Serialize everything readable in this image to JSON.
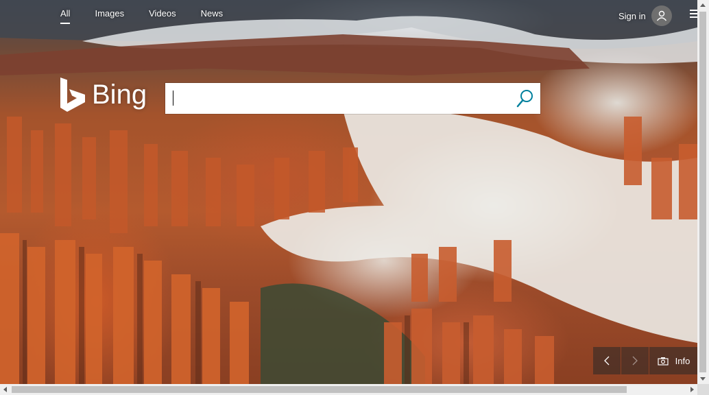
{
  "nav": {
    "tabs": [
      {
        "label": "All",
        "active": true
      },
      {
        "label": "Images",
        "active": false
      },
      {
        "label": "Videos",
        "active": false
      },
      {
        "label": "News",
        "active": false
      }
    ]
  },
  "header": {
    "signin_label": "Sign in",
    "avatar_icon": "user-avatar-icon",
    "menu_icon": "hamburger-menu-icon"
  },
  "logo": {
    "text": "Bing"
  },
  "search": {
    "value": "",
    "placeholder": "",
    "button_icon": "search-icon"
  },
  "bottombar": {
    "prev_icon": "chevron-left-icon",
    "next_icon": "chevron-right-icon",
    "info_label": "Info",
    "info_icon": "camera-icon"
  },
  "colors": {
    "accent": "#00809d",
    "overlay": "#282828"
  }
}
